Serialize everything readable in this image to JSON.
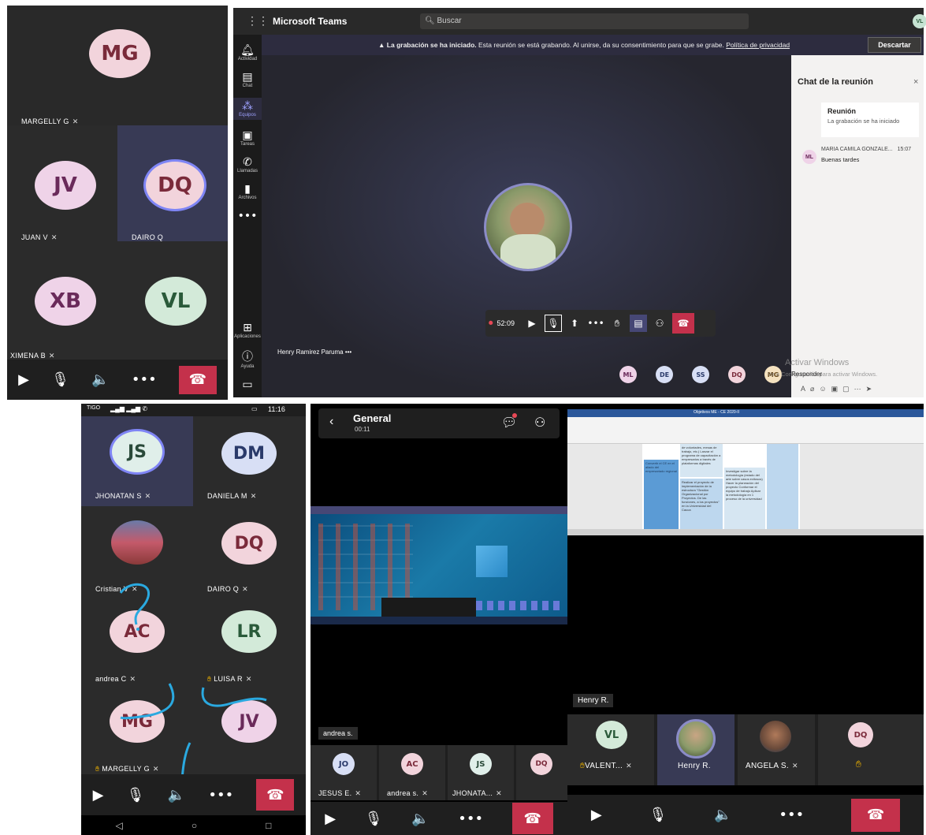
{
  "p1": {
    "tiles": [
      {
        "initials": "MG",
        "name": "MARGELLY G"
      },
      {
        "initials": "JV",
        "name": "JUAN V"
      },
      {
        "initials": "DQ",
        "name": "DAIRO Q"
      },
      {
        "initials": "XB",
        "name": "XIMENA B"
      },
      {
        "initials": "VL",
        "name": ""
      }
    ],
    "mic_off": "🎙̸"
  },
  "p2": {
    "app_title": "Microsoft Teams",
    "search_placeholder": "Buscar",
    "user_initials": "VL",
    "banner_bold": "La grabación se ha iniciado.",
    "banner_text": "Esta reunión se está grabando. Al unirse, da su consentimiento para que se grabe.",
    "banner_link": "Política de privacidad",
    "dismiss": "Descartar",
    "rail": [
      {
        "icon": "bell-icon",
        "label": "Actividad",
        "glyph": "🔔"
      },
      {
        "icon": "chat-icon",
        "label": "Chat",
        "glyph": "💬"
      },
      {
        "icon": "teams-icon",
        "label": "Equipos",
        "glyph": "👥"
      },
      {
        "icon": "tasks-icon",
        "label": "Tareas",
        "glyph": "🗒"
      },
      {
        "icon": "phone-icon",
        "label": "Llamadas",
        "glyph": "📞"
      },
      {
        "icon": "files-icon",
        "label": "Archivos",
        "glyph": "📄"
      },
      {
        "icon": "more-icon",
        "label": "",
        "glyph": "…"
      }
    ],
    "rail_bottom": [
      {
        "icon": "apps-icon",
        "label": "Aplicaciones",
        "glyph": "⊞"
      },
      {
        "icon": "help-icon",
        "label": "Ayuda",
        "glyph": "?"
      }
    ],
    "timer": "52:09",
    "presenter": "Henry Ramirez Paruma",
    "presenter_more": "•••",
    "chat_title": "Chat de la reunión",
    "meeting_label": "Reunión",
    "meeting_sub": "La grabación se ha iniciado",
    "msg_initials": "ML",
    "msg_author": "MARIA CAMILA GONZALE...",
    "msg_time": "15:07",
    "msg_text": "Buenas tardes",
    "reply": "Responder",
    "watermark1": "Activar Windows",
    "watermark2": "Ve a Configuración para activar Windows.",
    "participants": [
      "ML",
      "DE",
      "SS",
      "DQ",
      "MG"
    ]
  },
  "p3": {
    "carrier": "TIGO",
    "time": "11:16",
    "tiles": [
      {
        "initials": "JS",
        "name": "JHONATAN S"
      },
      {
        "initials": "DM",
        "name": "DANIELA M"
      },
      {
        "initials": "",
        "name": "Cristian V"
      },
      {
        "initials": "DQ",
        "name": "DAIRO Q"
      },
      {
        "initials": "AC",
        "name": "andrea C"
      },
      {
        "initials": "LR",
        "name": "LUISA R"
      },
      {
        "initials": "MG",
        "name": "MARGELLY G"
      },
      {
        "initials": "JV",
        "name": ""
      }
    ]
  },
  "p4": {
    "title": "General",
    "timer": "00:11",
    "share_name": "andrea s.",
    "participants": [
      {
        "initials": "JO",
        "name": "JESUS E."
      },
      {
        "initials": "AC",
        "name": "andrea s."
      },
      {
        "initials": "JS",
        "name": "JHONATA..."
      },
      {
        "initials": "DQ",
        "name": ""
      }
    ]
  },
  "p5": {
    "doc_title": "Objetivos ME - CE 2020-II",
    "doc_cell1": "Convertir el CE en el aliado del empresariado regional",
    "doc_cell2": "Realizar el proyecto de implementación de la estructura \"Gestión Organizacional por Proyectos. De las funciones, a los proyectos\" en la Universidad del Cauca",
    "doc_cell3": "Investigar sobre la metodología (estado del arte sobre casos exitosos) Hacer la planeación del proyecto Conformar el equipo de trabajo Aplicar la metodología en 1 proceso de la universidad",
    "doc_cell0": "de voluntades, mesas de trabajo, etc.) Lanzar el programa de capacitación a empresarios a través de plataformas digitales",
    "presenter": "Henry R.",
    "participants": [
      {
        "initials": "VL",
        "name": "VALENT..."
      },
      {
        "initials": "",
        "name": "Henry R."
      },
      {
        "initials": "",
        "name": "ANGELA S."
      },
      {
        "initials": "DQ",
        "name": ""
      }
    ]
  },
  "colors": {
    "teams_purple": "#464775",
    "hangup_red": "#c4314b",
    "annotation_blue": "#2aa9e0"
  }
}
